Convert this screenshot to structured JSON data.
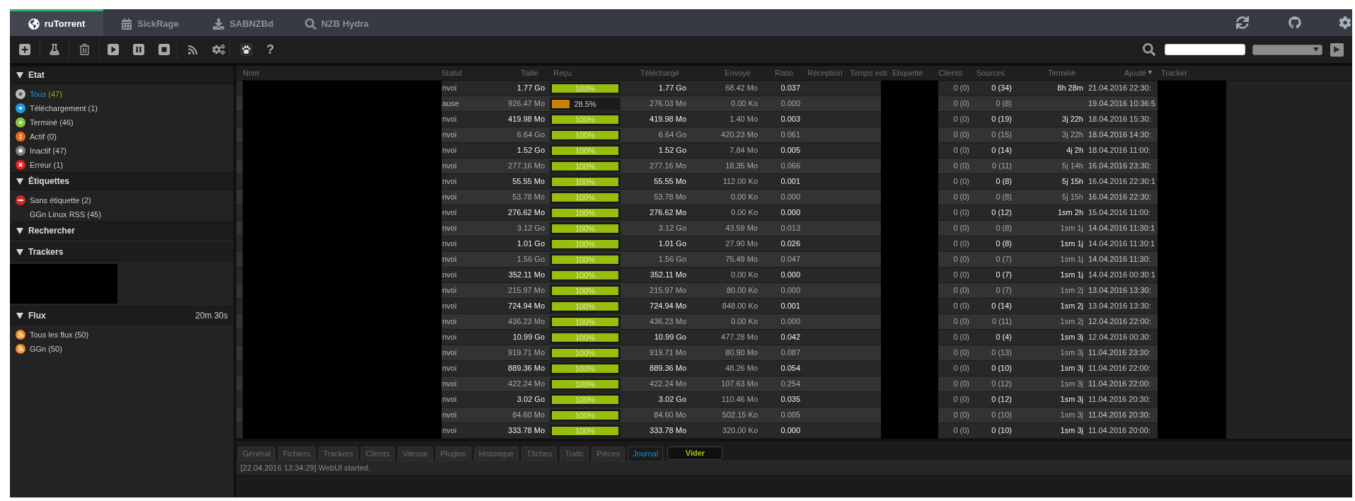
{
  "nav": {
    "tabs": [
      {
        "label": "ruTorrent",
        "kind": "globe",
        "selected": true
      },
      {
        "label": "SickRage",
        "kind": "calendar",
        "selected": false
      },
      {
        "label": "SABNZBd",
        "kind": "download",
        "selected": false
      },
      {
        "label": "NZB Hydra",
        "kind": "search",
        "selected": false
      }
    ]
  },
  "toolbar": {
    "help": "?"
  },
  "sidebar": {
    "sections": [
      {
        "title": "Etat",
        "expanded": true,
        "kind": "list",
        "items": [
          {
            "kind": "all",
            "label": "Tous",
            "count": "(47)",
            "selected": true
          },
          {
            "kind": "downloading",
            "label": "Téléchargement",
            "count": "(1)",
            "selected": false
          },
          {
            "kind": "finished",
            "label": "Terminé",
            "count": "(46)",
            "selected": false
          },
          {
            "kind": "active",
            "label": "Actif",
            "count": "(0)",
            "selected": false
          },
          {
            "kind": "inactive",
            "label": "Inactif",
            "count": "(47)",
            "selected": false
          },
          {
            "kind": "error",
            "label": "Erreur",
            "count": "(1)",
            "selected": false
          }
        ]
      },
      {
        "title": "Étiquettes",
        "expanded": true,
        "kind": "list",
        "items": [
          {
            "kind": "nolabel",
            "label": "Sans étiquette",
            "count": "(2)",
            "selected": false
          },
          {
            "kind": "plain",
            "label": "GGn Linux RSS",
            "count": "(45)",
            "selected": false
          }
        ]
      },
      {
        "title": "Rechercher",
        "expanded": true,
        "kind": "list"
      },
      {
        "title": "Trackers",
        "expanded": true,
        "kind": "redacted"
      },
      {
        "title": "Flux",
        "expanded": true,
        "kind": "list",
        "timer": "20m 30s",
        "items": [
          {
            "kind": "feed",
            "label": "Tous les flux",
            "count": "(50)",
            "selected": false
          },
          {
            "kind": "feed",
            "label": "GGn",
            "count": "(50)",
            "selected": false
          }
        ]
      }
    ]
  },
  "table": {
    "columns": [
      {
        "label": "Nom"
      },
      {
        "label": "Statut"
      },
      {
        "label": "Taille"
      },
      {
        "label": "Reçu"
      },
      {
        "label": "Téléchargé"
      },
      {
        "label": "Envoyé"
      },
      {
        "label": "Ratio"
      },
      {
        "label": "Réception"
      },
      {
        "label": "Temps esti"
      },
      {
        "label": "Etiquette"
      },
      {
        "label": "Clients"
      },
      {
        "label": "Sources"
      },
      {
        "label": "Terminé"
      },
      {
        "label": "Ajouté",
        "sort_mark": "▼"
      },
      {
        "label": "Tracker"
      }
    ],
    "rows": [
      {
        "status": "nvoi",
        "size": "1.77 Go",
        "received": {
          "level": 1,
          "text": "100%",
          "color": "#97bd0e"
        },
        "downloaded": "1.77 Go",
        "uploaded": "68.42 Mo",
        "ratio": "0.037",
        "clients": "0 (0)",
        "sources": "0 (34)",
        "finished": "8h 28m",
        "added": "21.04.2016 22:30:"
      },
      {
        "status": "ause",
        "size": "926.47 Mo",
        "received": {
          "level": 0.285,
          "text": "28.5%",
          "color": "#c8800a"
        },
        "downloaded": "276.03 Mo",
        "uploaded": "0.00 Ko",
        "ratio": "0.000",
        "clients": "0 (0)",
        "sources": "0 (8)",
        "added": "19.04.2016 10:36:5"
      },
      {
        "status": "nvoi",
        "size": "419.98 Mo",
        "received": {
          "level": 1,
          "text": "100%",
          "color": "#97bd0e"
        },
        "downloaded": "419.98 Mo",
        "uploaded": "1.40 Mo",
        "ratio": "0.003",
        "clients": "0 (0)",
        "sources": "0 (19)",
        "finished": "3j 22h",
        "added": "18.04.2016 15:30:"
      },
      {
        "status": "nvoi",
        "size": "6.64 Go",
        "received": {
          "level": 1,
          "text": "100%",
          "color": "#97bd0e"
        },
        "downloaded": "6.64 Go",
        "uploaded": "420.23 Mo",
        "ratio": "0.061",
        "clients": "0 (0)",
        "sources": "0 (15)",
        "finished": "3j 22h",
        "added": "18.04.2016 14:30:"
      },
      {
        "status": "nvoi",
        "size": "1.52 Go",
        "received": {
          "level": 1,
          "text": "100%",
          "color": "#97bd0e"
        },
        "downloaded": "1.52 Go",
        "uploaded": "7.84 Mo",
        "ratio": "0.005",
        "clients": "0 (0)",
        "sources": "0 (14)",
        "finished": "4j 2h",
        "added": "18.04.2016 11:00:"
      },
      {
        "status": "nvoi",
        "size": "277.16 Mo",
        "received": {
          "level": 1,
          "text": "100%",
          "color": "#97bd0e"
        },
        "downloaded": "277.16 Mo",
        "uploaded": "18.35 Mo",
        "ratio": "0.066",
        "clients": "0 (0)",
        "sources": "0 (11)",
        "finished": "5j 14h",
        "added": "16.04.2016 23:30:"
      },
      {
        "status": "nvoi",
        "size": "55.55 Mo",
        "received": {
          "level": 1,
          "text": "100%",
          "color": "#97bd0e"
        },
        "downloaded": "55.55 Mo",
        "uploaded": "112.00 Ko",
        "ratio": "0.001",
        "clients": "0 (0)",
        "sources": "0 (8)",
        "finished": "5j 15h",
        "added": "16.04.2016 22:30:1"
      },
      {
        "status": "nvoi",
        "size": "53.78 Mo",
        "received": {
          "level": 1,
          "text": "100%",
          "color": "#97bd0e"
        },
        "downloaded": "53.78 Mo",
        "uploaded": "0.00 Ko",
        "ratio": "0.000",
        "clients": "0 (0)",
        "sources": "0 (8)",
        "finished": "5j 15h",
        "added": "16.04.2016 22:30:"
      },
      {
        "status": "nvoi",
        "size": "276.62 Mo",
        "received": {
          "level": 1,
          "text": "100%",
          "color": "#97bd0e"
        },
        "downloaded": "276.62 Mo",
        "uploaded": "0.00 Ko",
        "ratio": "0.000",
        "clients": "0 (0)",
        "sources": "0 (12)",
        "finished": "1sm 2h",
        "added": "15.04.2016 11:00:"
      },
      {
        "status": "nvoi",
        "size": "3.12 Go",
        "received": {
          "level": 1,
          "text": "100%",
          "color": "#97bd0e"
        },
        "downloaded": "3.12 Go",
        "uploaded": "43.59 Mo",
        "ratio": "0.013",
        "clients": "0 (0)",
        "sources": "0 (8)",
        "finished": "1sm 1j",
        "added": "14.04.2016 11:30:1"
      },
      {
        "status": "nvoi",
        "size": "1.01 Go",
        "received": {
          "level": 1,
          "text": "100%",
          "color": "#97bd0e"
        },
        "downloaded": "1.01 Go",
        "uploaded": "27.90 Mo",
        "ratio": "0.026",
        "clients": "0 (0)",
        "sources": "0 (8)",
        "finished": "1sm 1j",
        "added": "14.04.2016 11:30:1"
      },
      {
        "status": "nvoi",
        "size": "1.56 Go",
        "received": {
          "level": 1,
          "text": "100%",
          "color": "#97bd0e"
        },
        "downloaded": "1.56 Go",
        "uploaded": "75.49 Mo",
        "ratio": "0.047",
        "clients": "0 (0)",
        "sources": "0 (7)",
        "finished": "1sm 1j",
        "added": "14.04.2016 11:30:"
      },
      {
        "status": "nvoi",
        "size": "352.11 Mo",
        "received": {
          "level": 1,
          "text": "100%",
          "color": "#97bd0e"
        },
        "downloaded": "352.11 Mo",
        "uploaded": "0.00 Ko",
        "ratio": "0.000",
        "clients": "0 (0)",
        "sources": "0 (7)",
        "finished": "1sm 1j",
        "added": "14.04.2016 00:30:1"
      },
      {
        "status": "nvoi",
        "size": "215.97 Mo",
        "received": {
          "level": 1,
          "text": "100%",
          "color": "#97bd0e"
        },
        "downloaded": "215.97 Mo",
        "uploaded": "80.00 Ko",
        "ratio": "0.000",
        "clients": "0 (0)",
        "sources": "0 (7)",
        "finished": "1sm 2j",
        "added": "13.04.2016 13:30:"
      },
      {
        "status": "nvoi",
        "size": "724.94 Mo",
        "received": {
          "level": 1,
          "text": "100%",
          "color": "#97bd0e"
        },
        "downloaded": "724.94 Mo",
        "uploaded": "848.00 Ko",
        "ratio": "0.001",
        "clients": "0 (0)",
        "sources": "0 (14)",
        "finished": "1sm 2j",
        "added": "13.04.2016 13:30:"
      },
      {
        "status": "nvoi",
        "size": "436.23 Mo",
        "received": {
          "level": 1,
          "text": "100%",
          "color": "#97bd0e"
        },
        "downloaded": "436.23 Mo",
        "uploaded": "0.00 Ko",
        "ratio": "0.000",
        "clients": "0 (0)",
        "sources": "0 (11)",
        "finished": "1sm 2j",
        "added": "12.04.2016 22:00:"
      },
      {
        "status": "nvoi",
        "size": "10.99 Go",
        "received": {
          "level": 1,
          "text": "100%",
          "color": "#97bd0e"
        },
        "downloaded": "10.99 Go",
        "uploaded": "477.28 Mo",
        "ratio": "0.042",
        "clients": "0 (0)",
        "sources": "0 (4)",
        "finished": "1sm 3j",
        "added": "12.04.2016 00:30:"
      },
      {
        "status": "nvoi",
        "size": "919.71 Mo",
        "received": {
          "level": 1,
          "text": "100%",
          "color": "#97bd0e"
        },
        "downloaded": "919.71 Mo",
        "uploaded": "80.90 Mo",
        "ratio": "0.087",
        "clients": "0 (0)",
        "sources": "0 (13)",
        "finished": "1sm 3j",
        "added": "11.04.2016 23:30:"
      },
      {
        "status": "nvoi",
        "size": "889.36 Mo",
        "received": {
          "level": 1,
          "text": "100%",
          "color": "#97bd0e"
        },
        "downloaded": "889.36 Mo",
        "uploaded": "48.26 Mo",
        "ratio": "0.054",
        "clients": "0 (0)",
        "sources": "0 (10)",
        "finished": "1sm 3j",
        "added": "11.04.2016 22:00:"
      },
      {
        "status": "nvoi",
        "size": "422.24 Mo",
        "received": {
          "level": 1,
          "text": "100%",
          "color": "#97bd0e"
        },
        "downloaded": "422.24 Mo",
        "uploaded": "107.63 Mo",
        "ratio": "0.254",
        "clients": "0 (0)",
        "sources": "0 (12)",
        "finished": "1sm 3j",
        "added": "11.04.2016 22:00:"
      },
      {
        "status": "nvoi",
        "size": "3.02 Go",
        "received": {
          "level": 1,
          "text": "100%",
          "color": "#97bd0e"
        },
        "downloaded": "3.02 Go",
        "uploaded": "110.46 Mo",
        "ratio": "0.035",
        "clients": "0 (0)",
        "sources": "0 (12)",
        "finished": "1sm 3j",
        "added": "11.04.2016 20:30:"
      },
      {
        "status": "nvoi",
        "size": "84.60 Mo",
        "received": {
          "level": 1,
          "text": "100%",
          "color": "#97bd0e"
        },
        "downloaded": "84.60 Mo",
        "uploaded": "502.15 Ko",
        "ratio": "0.005",
        "clients": "0 (0)",
        "sources": "0 (10)",
        "finished": "1sm 3j",
        "added": "11.04.2016 20:30:"
      },
      {
        "status": "nvoi",
        "size": "333.78 Mo",
        "received": {
          "level": 1,
          "text": "100%",
          "color": "#97bd0e"
        },
        "downloaded": "333.78 Mo",
        "uploaded": "320.00 Ko",
        "ratio": "0.000",
        "clients": "0 (0)",
        "sources": "0 (10)",
        "finished": "1sm 3j",
        "added": "11.04.2016 20:00:"
      }
    ]
  },
  "details": {
    "tabs": [
      {
        "label": "Général",
        "selected": false
      },
      {
        "label": "Fichiers",
        "selected": false
      },
      {
        "label": "Trackers",
        "selected": false
      },
      {
        "label": "Clients",
        "selected": false
      },
      {
        "label": "Vitesse",
        "selected": false
      },
      {
        "label": "Plugins",
        "selected": false
      },
      {
        "label": "Historique",
        "selected": false
      },
      {
        "label": "Tâches",
        "selected": false
      },
      {
        "label": "Trafic",
        "selected": false
      },
      {
        "label": "Pièces",
        "selected": false
      },
      {
        "label": "Journal",
        "selected": true
      }
    ],
    "clear_button": "Vider",
    "log": [
      "[22.04.2016 13:34:29] WebUI started."
    ]
  }
}
